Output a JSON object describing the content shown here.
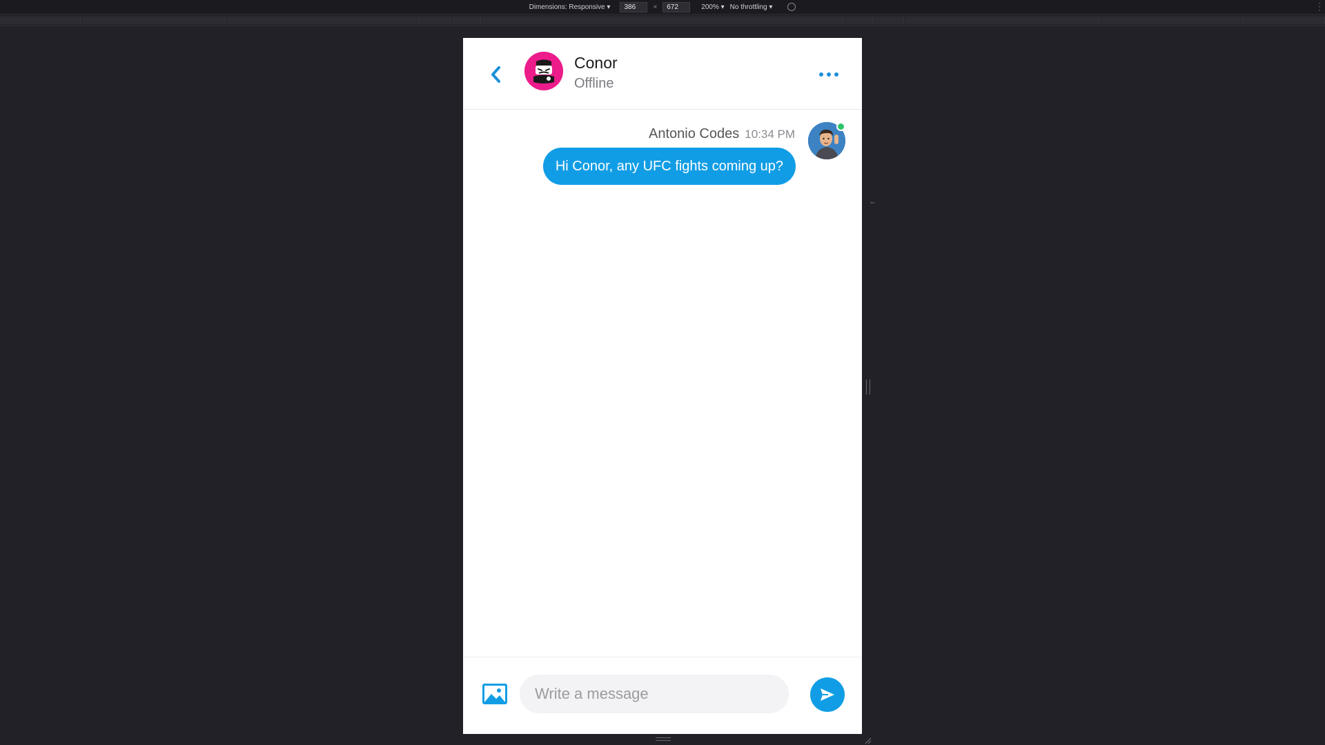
{
  "devtools": {
    "dimensions_label": "Dimensions: Responsive ▾",
    "width_value": "386",
    "times": "×",
    "height_value": "672",
    "zoom_label": "200% ▾",
    "throttling_label": "No throttling ▾"
  },
  "header": {
    "contact_name": "Conor",
    "contact_status": "Offline"
  },
  "messages": [
    {
      "sender": "Antonio Codes",
      "time": "10:34 PM",
      "text": "Hi Conor, any UFC fights coming up?"
    }
  ],
  "composer": {
    "placeholder": "Write a message"
  },
  "colors": {
    "accent": "#119de5",
    "contact_avatar": "#ec1c8b",
    "online": "#2fc36b"
  }
}
